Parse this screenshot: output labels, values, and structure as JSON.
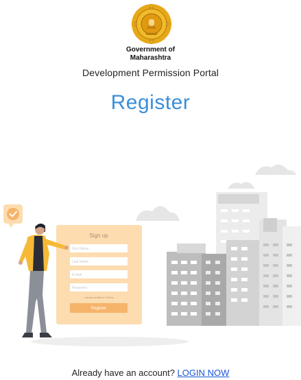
{
  "header": {
    "emblem_icon": "maharashtra-emblem-icon",
    "government_line1": "Government of",
    "government_line2": "Maharashtra",
    "portal_title": "Development Permission Portal"
  },
  "page": {
    "heading": "Register"
  },
  "illustration": {
    "form_title": "Sign up",
    "fields": [
      "First Name",
      "Last Name",
      "E-mail",
      "Password"
    ],
    "terms_text": "I accept conditions & Terms",
    "button_label": "Register",
    "check_icon": "check-icon"
  },
  "footer": {
    "prompt": "Already have an account?",
    "login_link": "LOGIN NOW"
  },
  "colors": {
    "accent": "#3b8fd9",
    "link": "#1a56d8",
    "form_bg": "#fddcb0",
    "button": "#f6b36a",
    "emblem_gold": "#e6a817"
  }
}
